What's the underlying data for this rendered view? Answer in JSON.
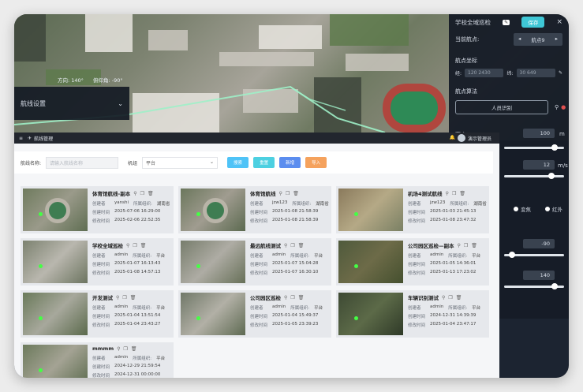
{
  "map": {
    "direction_label": "方向: 140°",
    "pitch_label": "俯仰角: -90°"
  },
  "route_panel": {
    "title": "航线设置",
    "chevron": "chevron-down-icon"
  },
  "right_panel": {
    "title": "学校全域巡检",
    "save_label": "保存",
    "waypoint_label": "当前航点:",
    "waypoint_value": "航点9",
    "coord_section": "航点坐标",
    "lng_label": "经:",
    "lng_value": "120  2430",
    "lat_label": "纬:",
    "lat_value": "30  649",
    "algo_section": "航点算法",
    "algo_button": "人员识别",
    "alt_label": "高度",
    "alt_value": "100",
    "alt_unit": "m",
    "speed_value": "12",
    "speed_unit": "m/s",
    "radio_a": "变焦",
    "radio_b": "红外",
    "num_a": "-90",
    "num_b": "140"
  },
  "window": {
    "title": "航线管理",
    "user": "演示管理员"
  },
  "filter": {
    "name_label": "航线名称:",
    "name_placeholder": "请输入航线名称",
    "platform_label": "机组",
    "platform_value": "平台",
    "search_label": "搜索",
    "reset_label": "重置",
    "add_label": "新增",
    "import_label": "导入"
  },
  "card_labels": {
    "creator": "创建者",
    "created": "创建时间",
    "modified": "修改时间"
  },
  "cards": [
    {
      "name": "体育馆航线-副本",
      "creator": "yanshi",
      "org": "所属组织:",
      "region": "湖南省",
      "created": "2025-07-06 16:29:00",
      "modified": "2025-02-06 22:52:35"
    },
    {
      "name": "体育馆航线",
      "creator": "jzw123",
      "org": "所属组织:",
      "region": "湖南省",
      "created": "2025-01-08 21:58:39",
      "modified": "2025-01-08 21:58:39"
    },
    {
      "name": "机场4测试航线",
      "creator": "jzw123",
      "org": "所属组织:",
      "region": "湖南省",
      "created": "2025-01-03 21:45:13",
      "modified": "2025-01-08 23:47:32"
    },
    {
      "name": "学校全域巡检",
      "creator": "admin",
      "org": "所属组织:",
      "region": "平台",
      "created": "2025-01-07 16:13:43",
      "modified": "2025-01-08 14:57:13"
    },
    {
      "name": "最远航线测试",
      "creator": "admin",
      "org": "所属组织:",
      "region": "平台",
      "created": "2025-01-07 15:04:28",
      "modified": "2025-01-07 16:30:10"
    },
    {
      "name": "公司园区巡检—副本",
      "creator": "admin",
      "org": "所属组织:",
      "region": "平台",
      "created": "2025-01-05 14:36:01",
      "modified": "2025-01-13 17:23:02"
    },
    {
      "name": "开发测试",
      "creator": "admin",
      "org": "所属组织:",
      "region": "平台",
      "created": "2025-01-04 13:51:54",
      "modified": "2025-01-04 23:43:27"
    },
    {
      "name": "公司园区巡检",
      "creator": "admin",
      "org": "所属组织:",
      "region": "平台",
      "created": "2025-01-04 15:49:37",
      "modified": "2025-01-05 23:39:23"
    },
    {
      "name": "车辆识别测试",
      "creator": "admin",
      "org": "所属组织:",
      "region": "平台",
      "created": "2024-12-31 14:39:39",
      "modified": "2025-01-04 23:47:17"
    },
    {
      "name": "mmmm",
      "creator": "admin",
      "org": "所属组织:",
      "region": "平台",
      "created": "2024-12-29 21:59:54",
      "modified": "2024-12-31 00:00:00"
    }
  ],
  "colors": {
    "search": "#4fc3f7",
    "reset": "#4dd0e1",
    "add": "#5b8def",
    "import": "#f5a25d",
    "accent": "#3fc7d6"
  }
}
